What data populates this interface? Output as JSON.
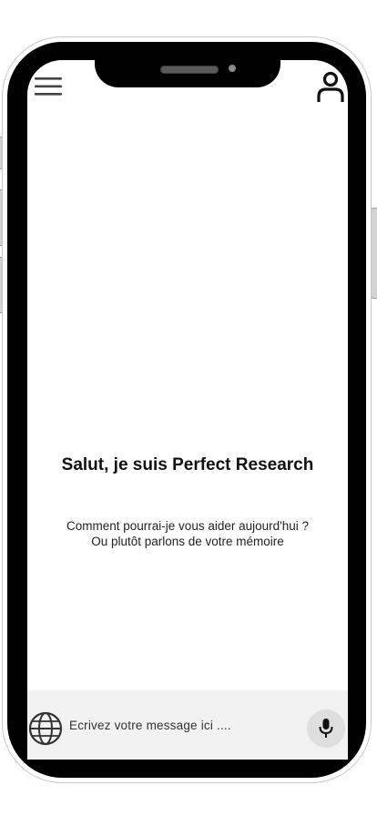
{
  "header": {
    "menu_icon": "hamburger-menu-icon",
    "profile_icon": "user-icon"
  },
  "main": {
    "greeting": "Salut, je suis Perfect Research",
    "subtitle_line1": "Comment pourrai-je vous aider aujourd'hui ?",
    "subtitle_line2": "Ou plutôt parlons de votre mémoire"
  },
  "composer": {
    "language_icon": "globe-icon",
    "placeholder": "Ecrivez votre message ici ....",
    "mic_icon": "microphone-icon"
  }
}
